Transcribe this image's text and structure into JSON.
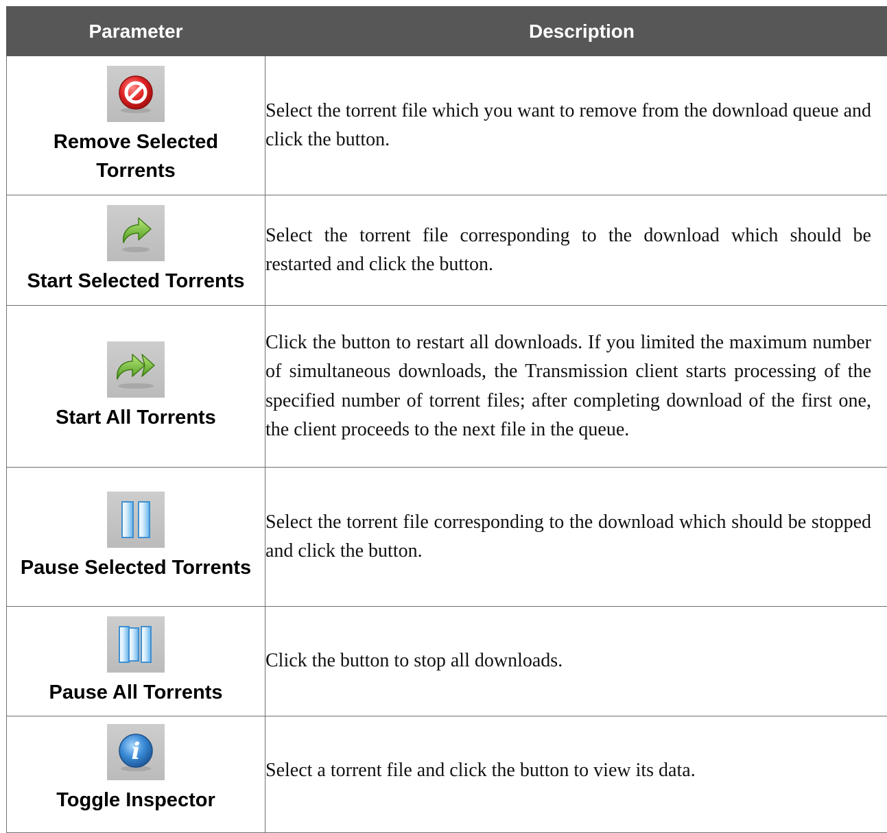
{
  "headers": {
    "parameter": "Parameter",
    "description": "Description"
  },
  "rows": [
    {
      "icon": "remove-icon",
      "name": "Remove Selected Torrents",
      "description": "Select the torrent file which you want to remove from the download queue and click the button."
    },
    {
      "icon": "start-icon",
      "name": "Start Selected Torrents",
      "description": "Select the torrent file corresponding to the download which should be restarted and click the button."
    },
    {
      "icon": "start-all-icon",
      "name": "Start All Torrents",
      "description": "Click the button to restart all downloads. If you limited the maximum number of simultaneous downloads, the Transmission client starts processing of the specified number of torrent files; after completing download of the first one, the client proceeds to the next file in the queue."
    },
    {
      "icon": "pause-icon",
      "name": "Pause Selected Torrents",
      "description": "Select the torrent file corresponding to the download which should be stopped and click the button."
    },
    {
      "icon": "pause-all-icon",
      "name": "Pause All Torrents",
      "description": "Click the button to stop all downloads."
    },
    {
      "icon": "info-icon",
      "name": "Toggle Inspector",
      "description": "Select a torrent file and click the button to view its data."
    }
  ],
  "colors": {
    "header_bg": "#575757",
    "header_text": "#ffffff",
    "border": "#6f6f6f",
    "icon_bg": "#c4c4c4"
  }
}
